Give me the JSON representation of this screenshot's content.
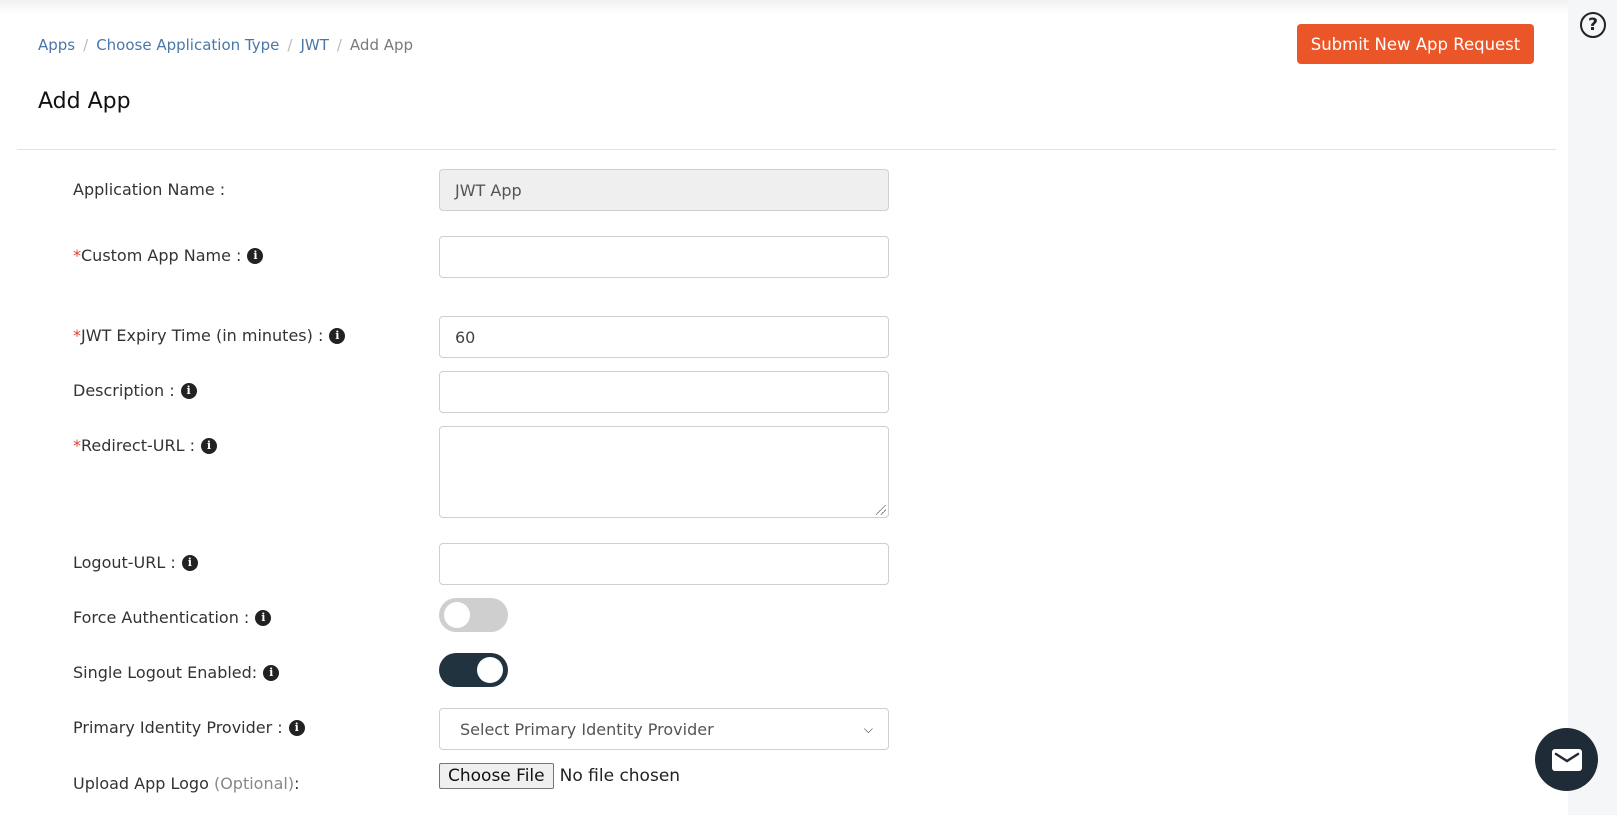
{
  "breadcrumb": {
    "items": [
      "Apps",
      "Choose Application Type",
      "JWT"
    ],
    "current": "Add App",
    "separator": "/"
  },
  "page_title": "Add App",
  "submit_button": "Submit New App Request",
  "help_icon_glyph": "?",
  "info_glyph": "i",
  "form": {
    "application_name": {
      "label": "Application Name :",
      "value": "JWT App",
      "disabled": true
    },
    "custom_app_name": {
      "required_mark": "*",
      "label": "Custom App Name :",
      "value": ""
    },
    "jwt_expiry": {
      "required_mark": "*",
      "label": "JWT Expiry Time (in minutes) :",
      "value": "60"
    },
    "description": {
      "label": "Description :",
      "value": ""
    },
    "redirect_url": {
      "required_mark": "*",
      "label": "Redirect-URL :",
      "value": ""
    },
    "logout_url": {
      "label": "Logout-URL :",
      "value": ""
    },
    "force_authentication": {
      "label": "Force Authentication :",
      "enabled": false
    },
    "single_logout": {
      "label": "Single Logout Enabled:",
      "enabled": true
    },
    "primary_idp": {
      "label": "Primary Identity Provider :",
      "selected": "Select Primary Identity Provider",
      "chevron": "⌄"
    },
    "upload_logo": {
      "label": "Upload App Logo",
      "optional": "(Optional)",
      "suffix": ":",
      "button": "Choose File",
      "status": "No file chosen"
    }
  },
  "colors": {
    "accent": "#eb5629",
    "toggle_on": "#223340",
    "link": "#4a77aa",
    "required": "#e23b3b"
  }
}
